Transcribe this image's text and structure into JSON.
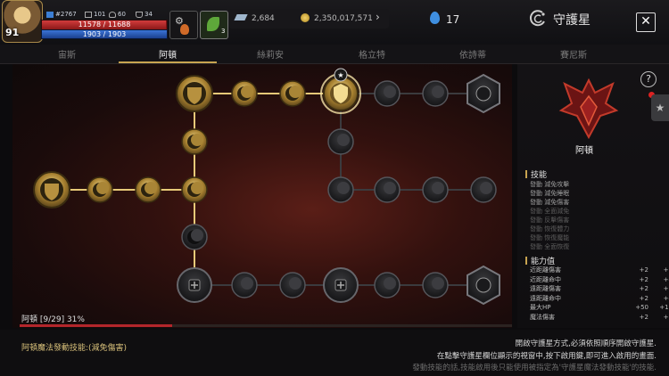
{
  "player": {
    "level": "91",
    "stats": [
      "#2767",
      "101",
      "60",
      "34"
    ],
    "hp_text": "11578 / 11688",
    "hp_fraction": 0.99,
    "mp_text": "1903 / 1903",
    "mp_fraction": 1.0,
    "slot_badge": "3"
  },
  "currency": {
    "crystals": "2,684",
    "gold": "2,350,017,571",
    "gems": "17"
  },
  "header": {
    "title": "守護星",
    "close_label": "✕"
  },
  "tabs": [
    "宙斯",
    "阿頓",
    "絲莉安",
    "格立特",
    "依詩蒂",
    "賽尼斯"
  ],
  "active_tab": 1,
  "progress": {
    "label": "阿頓 [9/29] 31%",
    "fraction": 0.31
  },
  "right_panel": {
    "name": "阿頓",
    "skills_title": "技能",
    "skills": [
      {
        "text": "發動 減免攻擊",
        "active": true
      },
      {
        "text": "發動 減免睡眠",
        "active": true
      },
      {
        "text": "發動 減免傷害",
        "active": true
      },
      {
        "text": "發動 全面減免",
        "active": false
      },
      {
        "text": "發動 反擊傷害",
        "active": false
      },
      {
        "text": "發動 恢復體力",
        "active": false
      },
      {
        "text": "發動 恢復魔能",
        "active": false
      },
      {
        "text": "發動 全面恢復",
        "active": false
      }
    ],
    "attr_title": "能力值",
    "attributes": [
      {
        "name": "近距離傷害",
        "v1": "+2",
        "v2": "+3"
      },
      {
        "name": "近距離命中",
        "v1": "+2",
        "v2": "+4"
      },
      {
        "name": "遠距離傷害",
        "v1": "+2",
        "v2": "+3"
      },
      {
        "name": "遠距離命中",
        "v1": "+2",
        "v2": "+4"
      },
      {
        "name": "最大HP",
        "v1": "+50",
        "v2": "+15"
      },
      {
        "name": "魔法傷害",
        "v1": "+2",
        "v2": "+3"
      }
    ],
    "help_label": "?",
    "side_label": "★"
  },
  "bottom": {
    "skill_text": "阿頓魔法發動技能:(減免傷害)",
    "info": [
      "開啟守護星方式,必須依照順序開啟守護星.",
      "在點擊守護星欄位顯示的視窗中,按下啟用鍵,即可進入啟用的畫面.",
      "發動技能的話,技能啟用後只能使用被指定為'守護星魔法發動技能'的技能."
    ]
  },
  "icons": {
    "avatar": "character-portrait",
    "crystal": "crystal-icon",
    "gold": "gold-coin-icon",
    "gem": "blue-gem-icon",
    "constellation": "spiral-star-icon",
    "node": "crescent-moon-icon",
    "shield": "shield-emblem-icon"
  },
  "colors": {
    "gold_accent": "#c8a450",
    "hp": "#c23030",
    "mp": "#2f5fbf",
    "progress": "#b3262b"
  }
}
